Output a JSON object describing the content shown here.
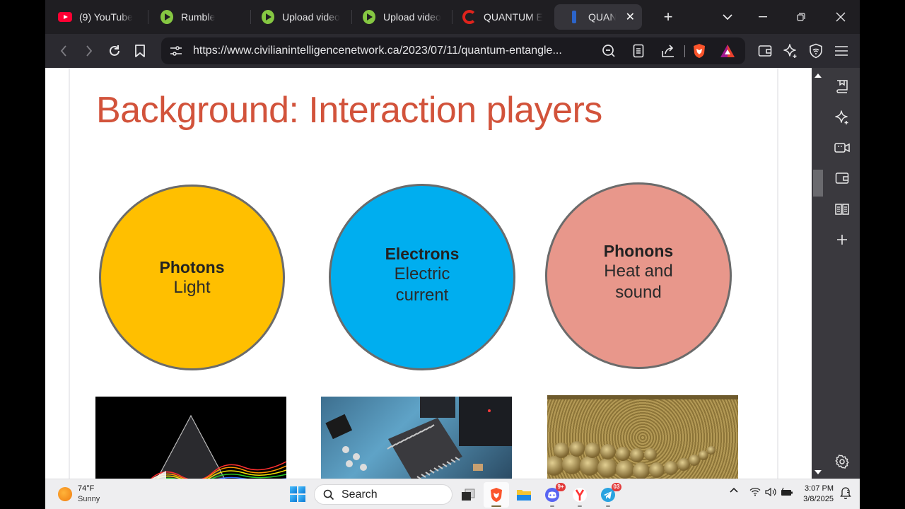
{
  "tabs": [
    {
      "label": "(9) YouTube",
      "icon": "youtube-icon",
      "active": false
    },
    {
      "label": "Rumble",
      "icon": "rumble-icon",
      "active": false
    },
    {
      "label": "Upload video",
      "icon": "rumble-icon",
      "active": false
    },
    {
      "label": "Upload video",
      "icon": "rumble-icon",
      "active": false
    },
    {
      "label": "QUANTUM E",
      "icon": "c-logo-icon",
      "active": false
    },
    {
      "label": "QUANTUM",
      "icon": "blue-bar-icon",
      "active": true
    }
  ],
  "window_controls": {
    "new_tab": "+",
    "tab_list": "⌄",
    "minimize": "–",
    "restore": "❐",
    "close": "✕"
  },
  "toolbar": {
    "url": "https://www.civilianintelligencenetwork.ca/2023/07/11/quantum-entangle..."
  },
  "slide": {
    "title": "Background: Interaction players",
    "players": [
      {
        "name": "Photons",
        "description": "Light",
        "color": "#ffbf00"
      },
      {
        "name": "Electrons",
        "description": "Electric current",
        "color": "#00aeef"
      },
      {
        "name": "Phonons",
        "description": "Heat and sound",
        "color": "#e8978b"
      }
    ],
    "images": [
      "prism-spectrum-image",
      "circuit-board-chip-image",
      "lattice-wave-image"
    ]
  },
  "sidebar": {
    "items": [
      "bookmarks-icon",
      "leo-ai-icon",
      "video-icon",
      "wallet-icon",
      "reading-list-icon",
      "add-icon"
    ],
    "settings": "settings-icon"
  },
  "taskbar": {
    "weather": {
      "temp": "74°F",
      "condition": "Sunny"
    },
    "search_label": "Search",
    "apps": [
      {
        "name": "task-view",
        "badge": null
      },
      {
        "name": "brave",
        "badge": null
      },
      {
        "name": "file-explorer",
        "badge": null
      },
      {
        "name": "discord",
        "badge": "9+"
      },
      {
        "name": "yandex",
        "badge": null
      },
      {
        "name": "telegram",
        "badge": "03"
      }
    ],
    "time": "3:07 PM",
    "date": "3/8/2025"
  }
}
